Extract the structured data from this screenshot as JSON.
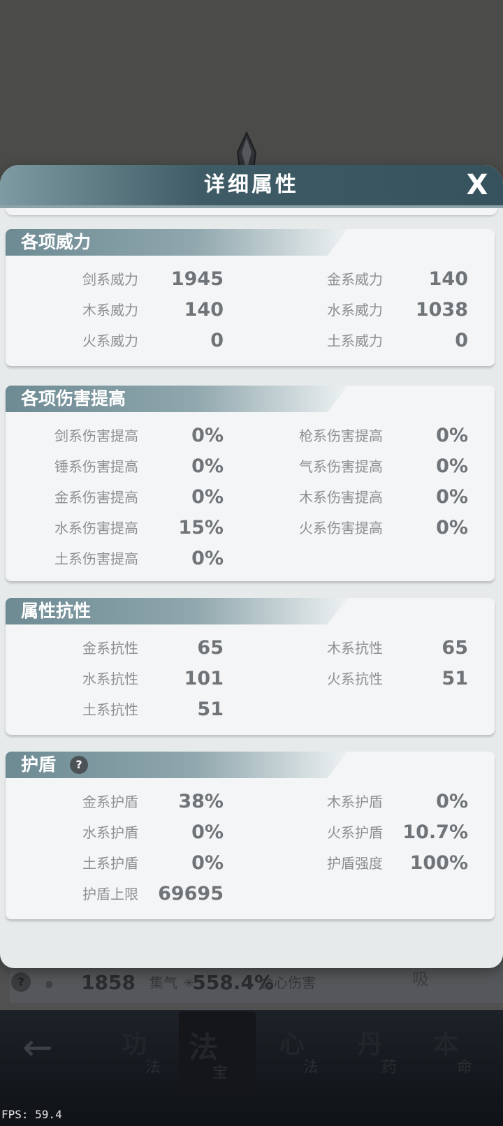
{
  "modal": {
    "title": "详细属性",
    "close": "X"
  },
  "sections": [
    {
      "title": "各项威力",
      "left": [
        {
          "label": "剑系威力",
          "value": "1945"
        },
        {
          "label": "木系威力",
          "value": "140"
        },
        {
          "label": "火系威力",
          "value": "0"
        }
      ],
      "right": [
        {
          "label": "金系威力",
          "value": "140"
        },
        {
          "label": "水系威力",
          "value": "1038"
        },
        {
          "label": "土系威力",
          "value": "0"
        }
      ]
    },
    {
      "title": "各项伤害提高",
      "left": [
        {
          "label": "剑系伤害提高",
          "value": "0%"
        },
        {
          "label": "锤系伤害提高",
          "value": "0%"
        },
        {
          "label": "金系伤害提高",
          "value": "0%"
        },
        {
          "label": "水系伤害提高",
          "value": "15%"
        },
        {
          "label": "土系伤害提高",
          "value": "0%"
        }
      ],
      "right": [
        {
          "label": "枪系伤害提高",
          "value": "0%"
        },
        {
          "label": "气系伤害提高",
          "value": "0%"
        },
        {
          "label": "木系伤害提高",
          "value": "0%"
        },
        {
          "label": "火系伤害提高",
          "value": "0%"
        }
      ]
    },
    {
      "title": "属性抗性",
      "left": [
        {
          "label": "金系抗性",
          "value": "65"
        },
        {
          "label": "水系抗性",
          "value": "101"
        },
        {
          "label": "土系抗性",
          "value": "51"
        }
      ],
      "right": [
        {
          "label": "木系抗性",
          "value": "65"
        },
        {
          "label": "火系抗性",
          "value": "51"
        }
      ]
    },
    {
      "title": "护盾",
      "help": "?",
      "left": [
        {
          "label": "金系护盾",
          "value": "38%"
        },
        {
          "label": "水系护盾",
          "value": "0%"
        },
        {
          "label": "土系护盾",
          "value": "0%"
        },
        {
          "label": "护盾上限",
          "value": "69695"
        }
      ],
      "right": [
        {
          "label": "木系护盾",
          "value": "0%"
        },
        {
          "label": "火系护盾",
          "value": "10.7%"
        },
        {
          "label": "护盾强度",
          "value": "100%"
        }
      ]
    }
  ],
  "underlay": {
    "help": "?",
    "stat1_label": "集气",
    "stat1_value": "1858",
    "stat2_label": "会心伤害",
    "stat2_value": "558.4%",
    "right_text": "吸"
  },
  "bottom_nav": {
    "back": "←",
    "items": [
      {
        "big": "功",
        "small": "法"
      },
      {
        "big": "法",
        "small": "宝"
      },
      {
        "big": "心",
        "small": "法"
      },
      {
        "big": "丹",
        "small": "药"
      },
      {
        "big": "本",
        "small": "命"
      }
    ]
  },
  "fps": "FPS: 59.4"
}
